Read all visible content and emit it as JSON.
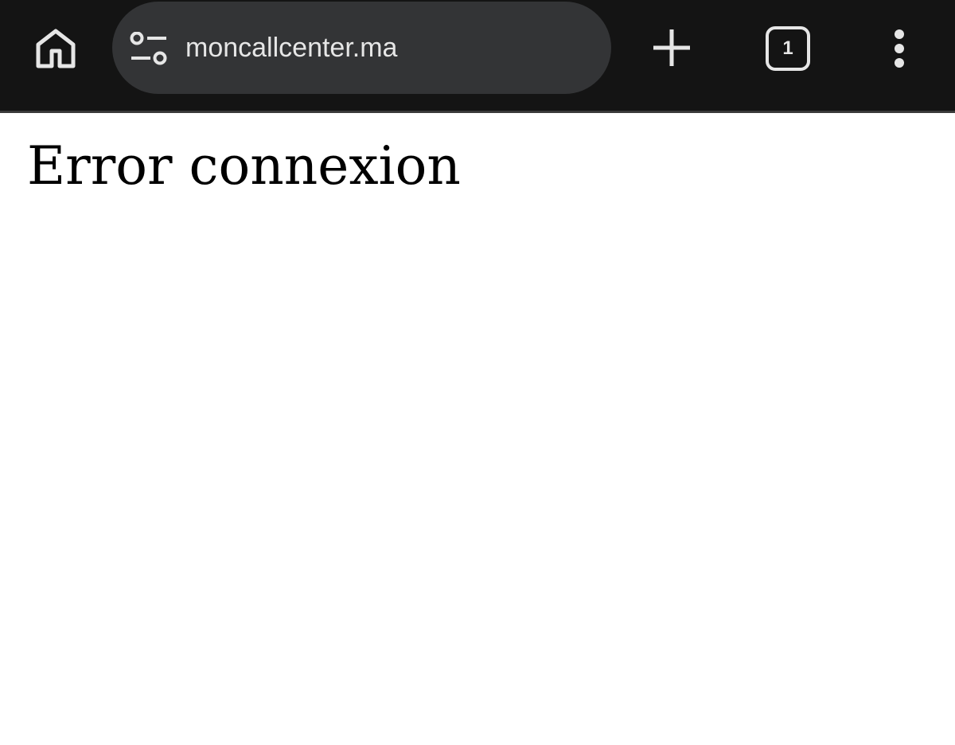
{
  "browser": {
    "omnibox": {
      "url": "moncallcenter.ma",
      "site_settings_icon": "tune-icon"
    },
    "home_icon": "home-icon",
    "new_tab_icon": "plus-icon",
    "tab_count": "1",
    "menu_icon": "more-vert-icon"
  },
  "page": {
    "message": "Error connexion"
  },
  "colors": {
    "toolbar_bg": "#141414",
    "omnibox_bg": "#333436",
    "toolbar_fg": "#e6e6e6",
    "page_bg": "#ffffff",
    "page_text": "#000000"
  }
}
